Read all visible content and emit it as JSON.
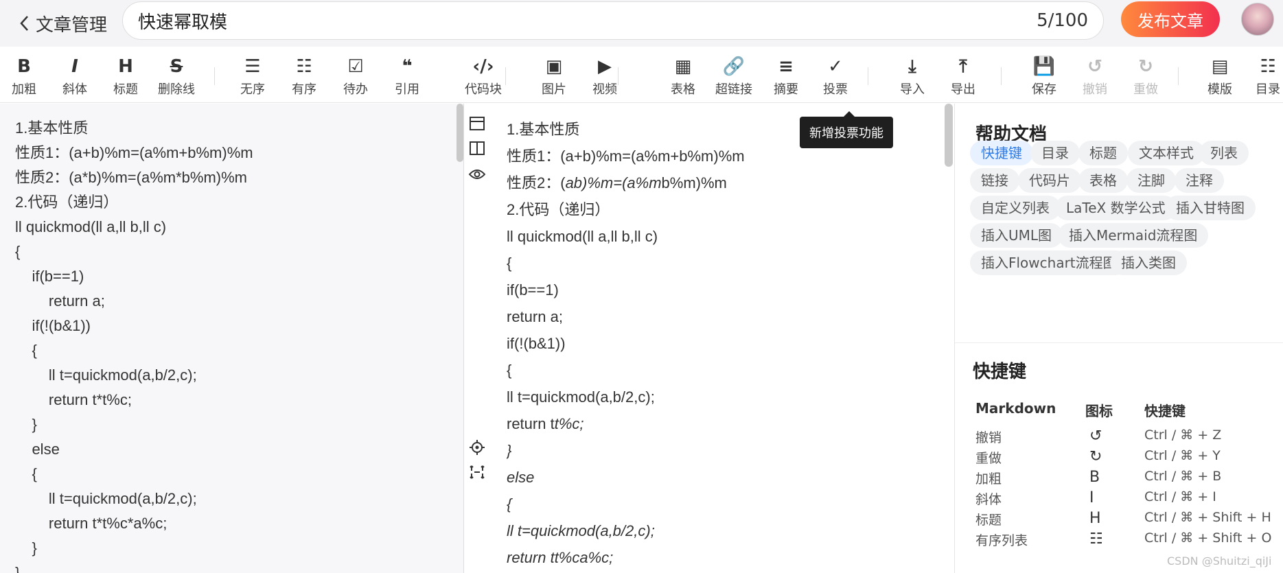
{
  "header": {
    "back_label": "文章管理",
    "title_value": "快速幂取模",
    "char_count": "5/100",
    "publish_label": "发布文章"
  },
  "toolbar": {
    "items": [
      {
        "icon": "B",
        "label": "加粗"
      },
      {
        "icon": "I",
        "label": "斜体"
      },
      {
        "icon": "H",
        "label": "标题"
      },
      {
        "icon": "S",
        "label": "删除线"
      },
      {
        "icon": "☰",
        "label": "无序"
      },
      {
        "icon": "☷",
        "label": "有序"
      },
      {
        "icon": "☑",
        "label": "待办"
      },
      {
        "icon": "❝",
        "label": "引用"
      },
      {
        "icon": "‹/›",
        "label": "代码块"
      },
      {
        "icon": "▣",
        "label": "图片"
      },
      {
        "icon": "▶",
        "label": "视频"
      },
      {
        "icon": "▦",
        "label": "表格"
      },
      {
        "icon": "🔗",
        "label": "超链接"
      },
      {
        "icon": "≡",
        "label": "摘要"
      },
      {
        "icon": "✓",
        "label": "投票"
      },
      {
        "icon": "⤓",
        "label": "导入"
      },
      {
        "icon": "⤒",
        "label": "导出"
      },
      {
        "icon": "💾",
        "label": "保存"
      },
      {
        "icon": "↺",
        "label": "撤销"
      },
      {
        "icon": "↻",
        "label": "重做"
      },
      {
        "icon": "▤",
        "label": "模版"
      },
      {
        "icon": "☷",
        "label": "目录"
      }
    ],
    "tooltip": "新增投票功能"
  },
  "editor": {
    "lines": [
      "1.基本性质",
      "性质1：(a+b)%m=(a%m+b%m)%m",
      "性质2：(a*b)%m=(a%m*b%m)%m",
      "2.代码（递归）",
      "ll quickmod(ll a,ll b,ll c)",
      "{",
      "    if(b==1)",
      "        return a;",
      "    if(!(b&1))",
      "    {",
      "        ll t=quickmod(a,b/2,c);",
      "        return t*t%c;",
      "    }",
      "    else",
      "    {",
      "        ll t=quickmod(a,b/2,c);",
      "        return t*t%c*a%c;",
      "    }",
      "}"
    ]
  },
  "preview": {
    "lines": [
      {
        "text": "1.基本性质"
      },
      {
        "text": "性质1：(a+b)%m=(a%m+b%m)%m"
      },
      {
        "pre": "性质2：(",
        "it": "ab)%m=(a%m",
        "post": "b%m)%m"
      },
      {
        "text": "2.代码（递归）"
      },
      {
        "text": "ll quickmod(ll a,ll b,ll c)"
      },
      {
        "text": "{"
      },
      {
        "text": "if(b==1)"
      },
      {
        "text": "return a;"
      },
      {
        "text": "if(!(b&1))"
      },
      {
        "text": "{"
      },
      {
        "text": "ll t=quickmod(a,b/2,c);"
      },
      {
        "pre": "return t",
        "it": "t%c;",
        "post": ""
      },
      {
        "pre": "",
        "it": "}",
        "post": ""
      },
      {
        "pre": "",
        "it": "else",
        "post": ""
      },
      {
        "pre": "",
        "it": "{",
        "post": ""
      },
      {
        "pre": "",
        "it": "ll t=quickmod(a,b/2,c);",
        "post": ""
      },
      {
        "pre": "",
        "it": "return tt%ca%c;",
        "post": ""
      }
    ]
  },
  "help": {
    "title": "帮助文档",
    "tags": [
      "快捷键",
      "目录",
      "标题",
      "文本样式",
      "列表",
      "链接",
      "代码片",
      "表格",
      "注脚",
      "注释",
      "自定义列表",
      "LaTeX 数学公式",
      "插入甘特图",
      "插入UML图",
      "插入Mermaid流程图",
      "插入Flowchart流程图",
      "插入类图"
    ],
    "shortcut_title": "快捷键",
    "table_headers": [
      "Markdown",
      "图标",
      "快捷键"
    ],
    "rows": [
      {
        "name": "撤销",
        "icon": "↺",
        "keys": "Ctrl / ⌘ + Z"
      },
      {
        "name": "重做",
        "icon": "↻",
        "keys": "Ctrl / ⌘ + Y"
      },
      {
        "name": "加粗",
        "icon": "B",
        "keys": "Ctrl / ⌘ + B"
      },
      {
        "name": "斜体",
        "icon": "I",
        "keys": "Ctrl / ⌘ + I"
      },
      {
        "name": "标题",
        "icon": "H",
        "keys": "Ctrl / ⌘ + Shift + H"
      },
      {
        "name": "有序列表",
        "icon": "☷",
        "keys": "Ctrl / ⌘ + Shift + O"
      }
    ]
  },
  "watermark": "CSDN @Shuitzi_qiJi"
}
